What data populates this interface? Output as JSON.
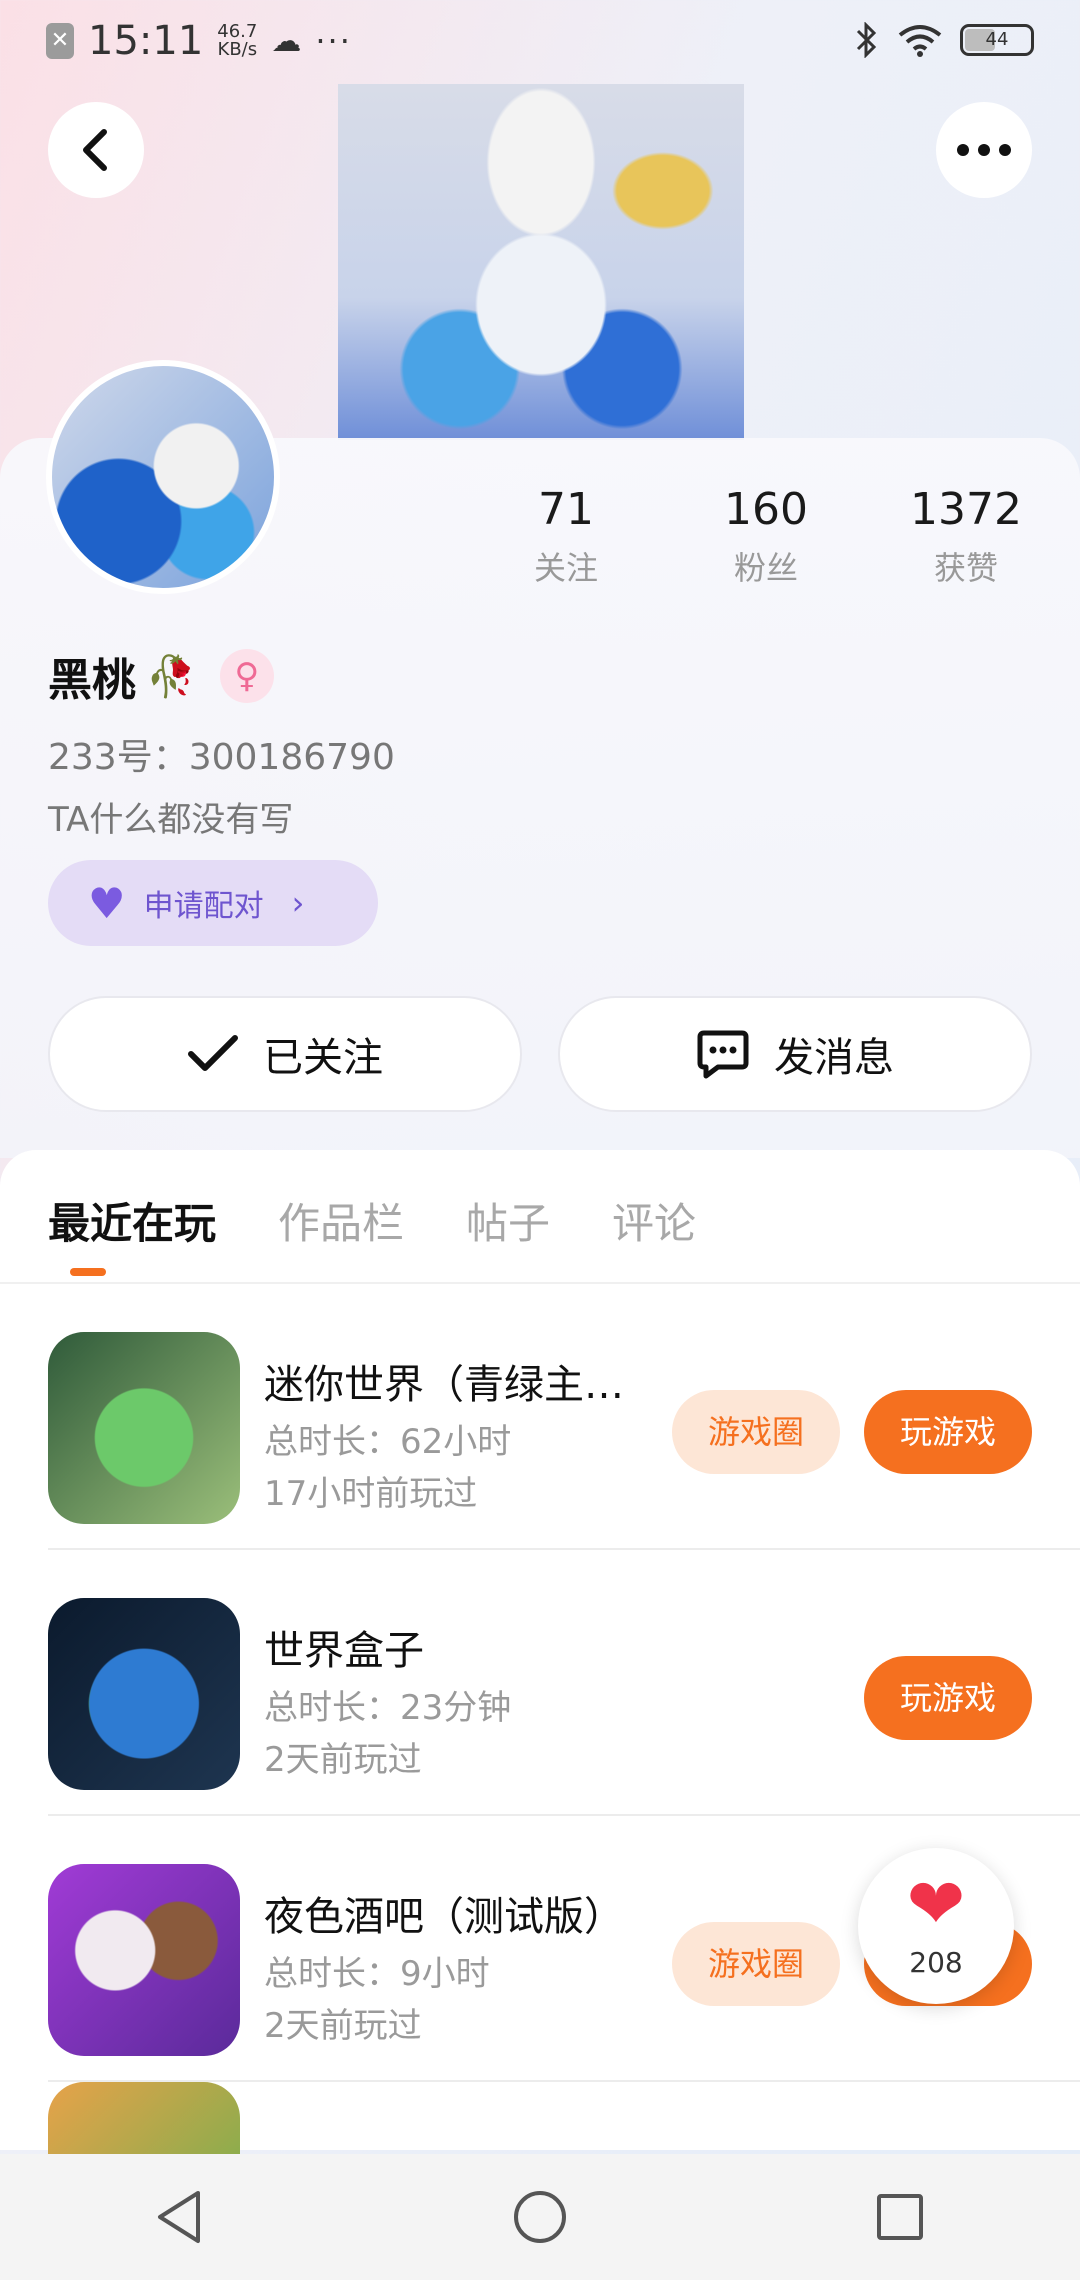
{
  "status_bar": {
    "time": "15:11",
    "speed_value": "46.7",
    "speed_unit": "KB/s",
    "battery": "44",
    "more": "···"
  },
  "header": {
    "back_icon": "chevron-left-icon",
    "more_icon": "more-dots-icon"
  },
  "stats": [
    {
      "value": "71",
      "label": "关注"
    },
    {
      "value": "160",
      "label": "粉丝"
    },
    {
      "value": "1372",
      "label": "获赞"
    }
  ],
  "profile": {
    "name": "黑桃",
    "gender_symbol": "♀",
    "uid": "233号：300186790",
    "bio": "TA什么都没有写",
    "pair_label": "申请配对"
  },
  "actions": {
    "follow_label": "已关注",
    "message_label": "发消息"
  },
  "tabs": [
    "最近在玩",
    "作品栏",
    "帖子",
    "评论"
  ],
  "games": [
    {
      "title": "迷你世界（青绿主…",
      "duration": "总时长：62小时",
      "last_played": "17小时前玩过",
      "circle_label": "游戏圈",
      "play_label": "玩游戏"
    },
    {
      "title": "世界盒子",
      "duration": "总时长：23分钟",
      "last_played": "2天前玩过",
      "play_label": "玩游戏"
    },
    {
      "title": "夜色酒吧（测试版）",
      "duration": "总时长：9小时",
      "last_played": "2天前玩过",
      "circle_label": "游戏圈",
      "play_label": "玩游戏"
    }
  ],
  "like_bubble": {
    "count": "208"
  },
  "colors": {
    "accent": "#f5701f",
    "pair_bg": "#e4dcf6",
    "heart": "#f0334a"
  }
}
